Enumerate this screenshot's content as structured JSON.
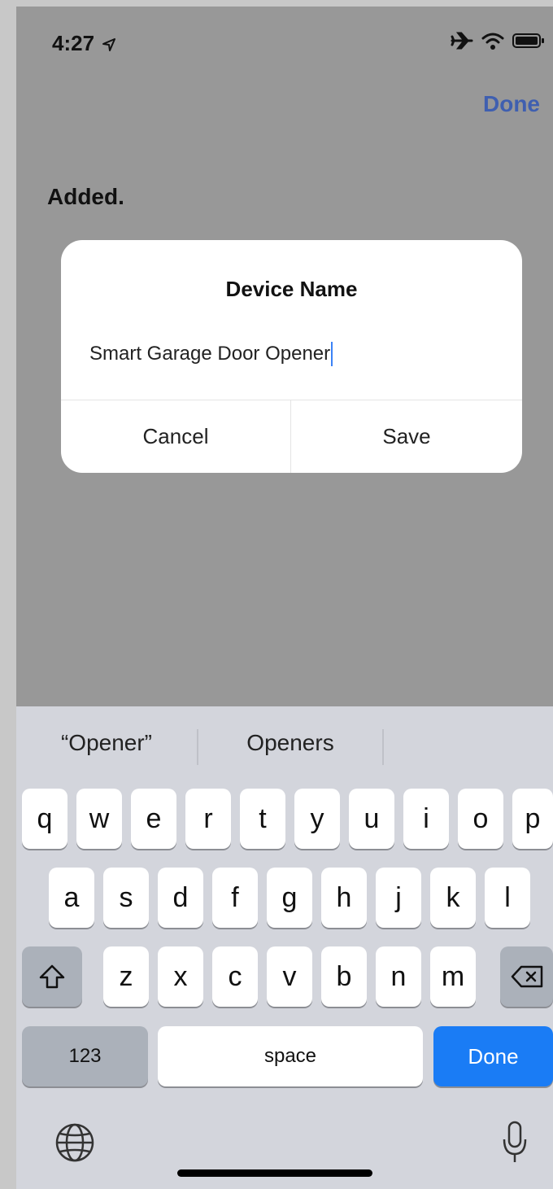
{
  "status_bar": {
    "time": "4:27",
    "icons": [
      "location-arrow-icon",
      "airplane-icon",
      "wifi-icon",
      "battery-icon"
    ]
  },
  "nav": {
    "done_label": "Done"
  },
  "content": {
    "added_label": "Added."
  },
  "dialog": {
    "title": "Device Name",
    "input_value": "Smart Garage Door Opener",
    "cancel_label": "Cancel",
    "save_label": "Save"
  },
  "keyboard": {
    "suggestions": [
      "“Opener”",
      "Openers"
    ],
    "row1": [
      "q",
      "w",
      "e",
      "r",
      "t",
      "y",
      "u",
      "i",
      "o",
      "p"
    ],
    "row2": [
      "a",
      "s",
      "d",
      "f",
      "g",
      "h",
      "j",
      "k",
      "l"
    ],
    "row3": [
      "z",
      "x",
      "c",
      "v",
      "b",
      "n",
      "m"
    ],
    "numbers_label": "123",
    "space_label": "space",
    "return_label": "Done",
    "icons": [
      "shift-icon",
      "backspace-icon",
      "globe-icon",
      "microphone-icon"
    ]
  },
  "colors": {
    "accent": "#1a7cf5",
    "link": "#3f5fb0",
    "overlay": "#989898"
  }
}
